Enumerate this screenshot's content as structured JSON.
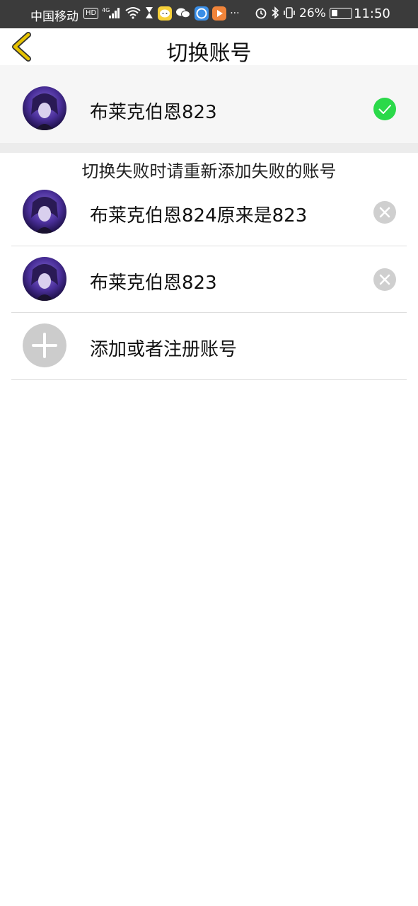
{
  "status_bar": {
    "carrier": "中国移动",
    "hd": "HD",
    "network": "4G",
    "more": "···",
    "battery_pct": "26%",
    "time": "11:50",
    "icons": [
      "hd-icon",
      "signal-icon",
      "wifi-icon",
      "hourglass-icon",
      "app-chat-icon",
      "wechat-icon",
      "browser-icon",
      "video-app-icon",
      "alarm-icon",
      "bluetooth-icon",
      "vibrate-icon",
      "battery-icon"
    ]
  },
  "header": {
    "title": "切换账号",
    "back_icon": "chevron-left-icon",
    "accent": "#e6c200"
  },
  "current_account": {
    "name": "布莱克伯恩823",
    "status_icon": "check-circle-icon",
    "status_color": "#2bd94a"
  },
  "hint": "切换失败时请重新添加失败的账号",
  "accounts": [
    {
      "name": "布莱克伯恩824原来是823",
      "action_icon": "remove-circle-icon"
    },
    {
      "name": "布莱克伯恩823",
      "action_icon": "remove-circle-icon"
    }
  ],
  "add_account": {
    "label": "添加或者注册账号",
    "icon": "plus-circle-icon"
  }
}
